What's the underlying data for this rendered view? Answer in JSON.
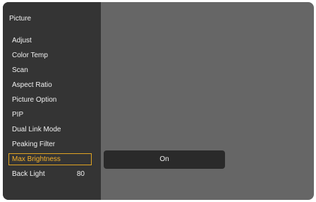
{
  "menu": {
    "title": "Picture",
    "items": [
      {
        "label": "Adjust",
        "value": ""
      },
      {
        "label": "Color Temp",
        "value": ""
      },
      {
        "label": "Scan",
        "value": ""
      },
      {
        "label": "Aspect Ratio",
        "value": ""
      },
      {
        "label": "Picture Option",
        "value": ""
      },
      {
        "label": "PIP",
        "value": ""
      },
      {
        "label": "Dual Link Mode",
        "value": ""
      },
      {
        "label": "Peaking Filter",
        "value": ""
      },
      {
        "label": "Max Brightness",
        "value": ""
      },
      {
        "label": "Back Light",
        "value": "80"
      }
    ],
    "selected_item": "Max Brightness"
  },
  "submenu": {
    "options": [
      "On"
    ]
  },
  "colors": {
    "highlight": "#e0a422",
    "menu_background": "#343434",
    "screen_background": "#666666"
  }
}
